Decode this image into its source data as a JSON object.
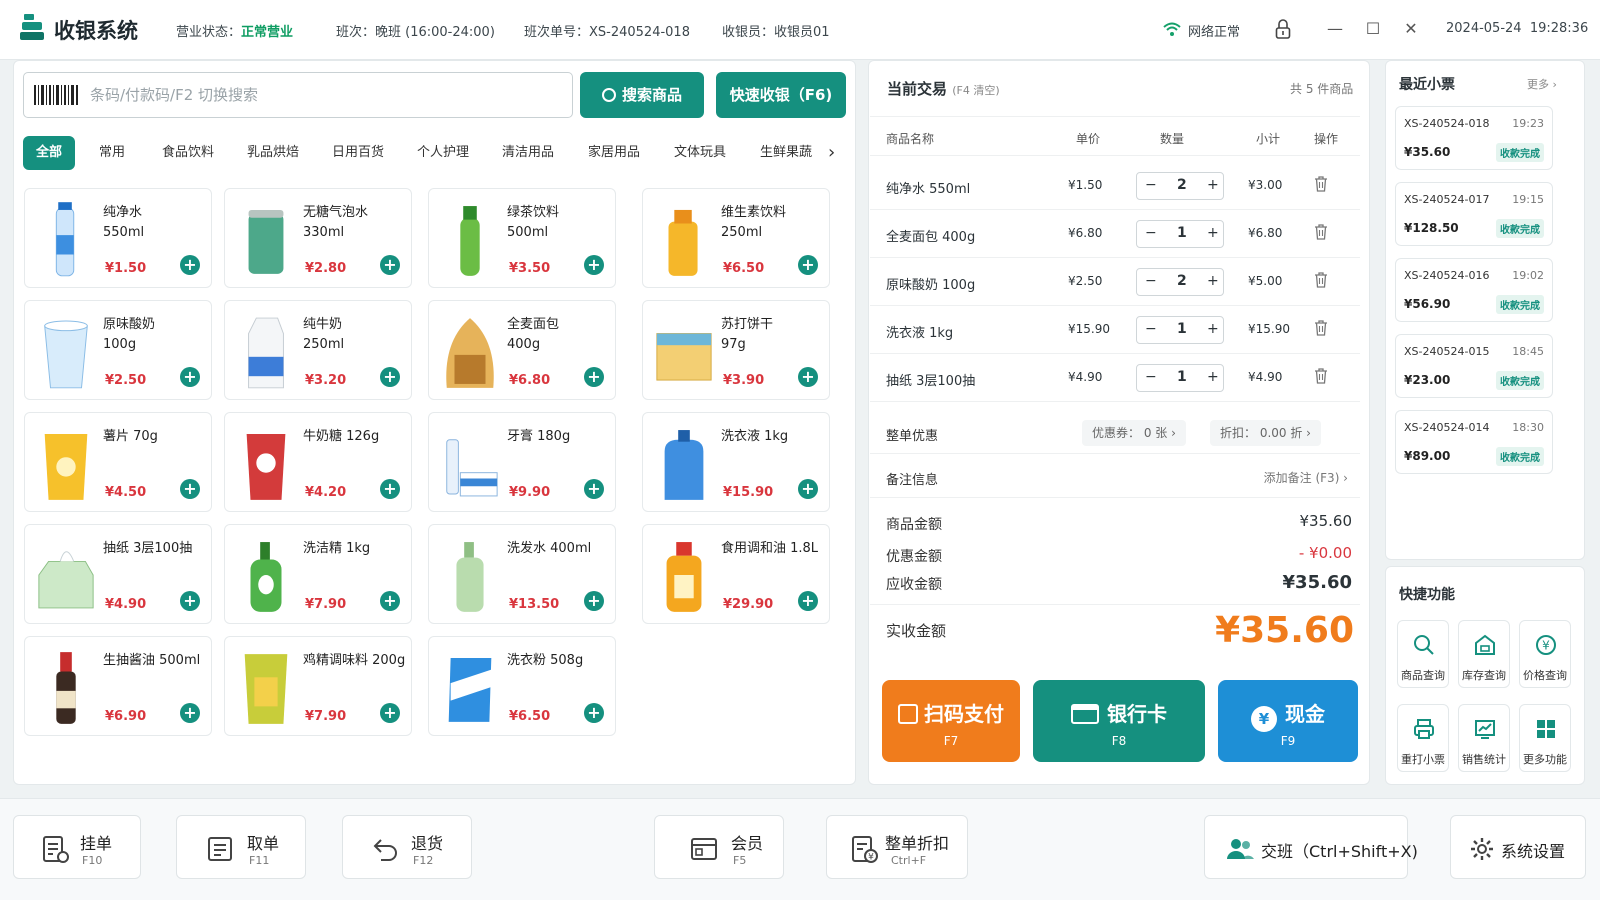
{
  "header": {
    "app_title": "收银系统",
    "status_label": "营业状态：",
    "status_value": "正常营业",
    "shift": "班次：晚班 (16:00-24:00)",
    "shift_no": "班次单号：XS-240524-018",
    "cashier": "收银员：收银员01",
    "network": "网络正常",
    "date": "2024-05-24",
    "time": "19:28:36"
  },
  "search": {
    "placeholder": "条码/付款码/F2 切换搜索",
    "search_btn": "搜索商品",
    "quick_btn": "快速收银（F6)"
  },
  "categories": [
    "全部",
    "常用",
    "食品饮料",
    "乳品烘焙",
    "日用百货",
    "个人护理",
    "清洁用品",
    "家居用品",
    "文体玩具",
    "生鲜果蔬"
  ],
  "products": [
    {
      "name": "纯净水",
      "spec": "550ml",
      "price": "¥1.50"
    },
    {
      "name": "无糖气泡水",
      "spec": "330ml",
      "price": "¥2.80"
    },
    {
      "name": "绿茶饮料",
      "spec": "500ml",
      "price": "¥3.50"
    },
    {
      "name": "维生素饮料",
      "spec": "250ml",
      "price": "¥6.50"
    },
    {
      "name": "原味酸奶",
      "spec": "100g",
      "price": "¥2.50"
    },
    {
      "name": "纯牛奶",
      "spec": "250ml",
      "price": "¥3.20"
    },
    {
      "name": "全麦面包",
      "spec": "400g",
      "price": "¥6.80"
    },
    {
      "name": "苏打饼干",
      "spec": "97g",
      "price": "¥3.90"
    },
    {
      "name": "薯片 70g",
      "spec": "",
      "price": "¥4.50"
    },
    {
      "name": "牛奶糖 126g",
      "spec": "",
      "price": "¥4.20"
    },
    {
      "name": "牙膏 180g",
      "spec": "",
      "price": "¥9.90"
    },
    {
      "name": "洗衣液 1kg",
      "spec": "",
      "price": "¥15.90"
    },
    {
      "name": "抽纸 3层100抽",
      "spec": "",
      "price": "¥4.90"
    },
    {
      "name": "洗洁精 1kg",
      "spec": "",
      "price": "¥7.90"
    },
    {
      "name": "洗发水 400ml",
      "spec": "",
      "price": "¥13.50"
    },
    {
      "name": "食用调和油 1.8L",
      "spec": "",
      "price": "¥29.90"
    },
    {
      "name": "生抽酱油 500ml",
      "spec": "",
      "price": "¥6.90"
    },
    {
      "name": "鸡精调味料 200g",
      "spec": "",
      "price": "¥7.90"
    },
    {
      "name": "洗衣粉 508g",
      "spec": "",
      "price": "¥6.50"
    }
  ],
  "transaction": {
    "title": "当前交易",
    "clear_hint": "(F4 清空)",
    "count": "共 5 件商品",
    "columns": [
      "商品名称",
      "单价",
      "数量",
      "小计",
      "操作"
    ],
    "items": [
      {
        "name": "纯净水 550ml",
        "price": "¥1.50",
        "qty": "2",
        "subtotal": "¥3.00"
      },
      {
        "name": "全麦面包 400g",
        "price": "¥6.80",
        "qty": "1",
        "subtotal": "¥6.80"
      },
      {
        "name": "原味酸奶 100g",
        "price": "¥2.50",
        "qty": "2",
        "subtotal": "¥5.00"
      },
      {
        "name": "洗衣液 1kg",
        "price": "¥15.90",
        "qty": "1",
        "subtotal": "¥15.90"
      },
      {
        "name": "抽纸 3层100抽",
        "price": "¥4.90",
        "qty": "1",
        "subtotal": "¥4.90"
      }
    ],
    "discount_label": "整单优惠",
    "coupon": "优惠券：  0  张  ›",
    "rate": "折扣：   0.00  折  ›",
    "note_label": "备注信息",
    "note_action": "添加备注 (F3)  ›",
    "goods_amount_label": "商品金额",
    "goods_amount": "¥35.60",
    "discount_amount_label": "优惠金额",
    "discount_amount": "- ¥0.00",
    "due_label": "应收金额",
    "due": "¥35.60",
    "paid_label": "实收金额",
    "paid": "¥35.60"
  },
  "payment": {
    "scan": "扫码支付",
    "scan_key": "F7",
    "card": "银行卡",
    "card_key": "F8",
    "cash": "现金",
    "cash_key": "F9"
  },
  "receipts": {
    "title": "最近小票",
    "more": "更多  ›",
    "items": [
      {
        "no": "XS-240524-018",
        "time": "19:23",
        "amount": "¥35.60",
        "status": "收款完成"
      },
      {
        "no": "XS-240524-017",
        "time": "19:15",
        "amount": "¥128.50",
        "status": "收款完成"
      },
      {
        "no": "XS-240524-016",
        "time": "19:02",
        "amount": "¥56.90",
        "status": "收款完成"
      },
      {
        "no": "XS-240524-015",
        "time": "18:45",
        "amount": "¥23.00",
        "status": "收款完成"
      },
      {
        "no": "XS-240524-014",
        "time": "18:30",
        "amount": "¥89.00",
        "status": "收款完成"
      }
    ]
  },
  "quick": {
    "title": "快捷功能",
    "items": [
      "商品查询",
      "库存查询",
      "价格查询",
      "重打小票",
      "销售统计",
      "更多功能"
    ]
  },
  "footer": [
    {
      "label": "挂单",
      "key": "F10"
    },
    {
      "label": "取单",
      "key": "F11"
    },
    {
      "label": "退货",
      "key": "F12"
    },
    {
      "label": "会员",
      "key": "F5"
    },
    {
      "label": "整单折扣",
      "key": "Ctrl+F"
    },
    {
      "label": "交班（Ctrl+Shift+X)",
      "key": ""
    },
    {
      "label": "系统设置",
      "key": ""
    }
  ],
  "colors": {
    "accent": "#15907f",
    "price": "#d9363e",
    "scan": "#f07c1c",
    "cash": "#1e8fd6"
  }
}
